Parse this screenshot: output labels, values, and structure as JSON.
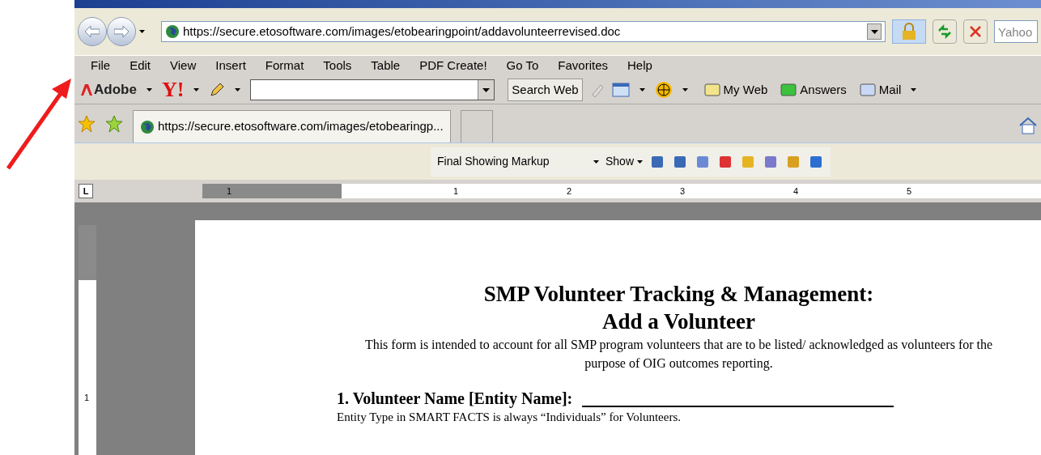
{
  "address_bar": {
    "url": "https://secure.etosoftware.com/images/etobearingpoint/addavolunteerrevised.doc"
  },
  "search_field": {
    "placeholder": "Yahoo"
  },
  "menu": [
    "File",
    "Edit",
    "View",
    "Insert",
    "Format",
    "Tools",
    "Table",
    "PDF Create!",
    "Go To",
    "Favorites",
    "Help"
  ],
  "toolbar": {
    "adobe": "Adobe",
    "yahoo": "Y!",
    "search_button": "Search Web",
    "items": [
      "My Web",
      "Answers",
      "Mail"
    ]
  },
  "tabs": [
    {
      "title": "https://secure.etosoftware.com/images/etobearingp...",
      "selected": true
    }
  ],
  "word_toolbar": {
    "markup_dropdown": "Final Showing Markup",
    "show_button": "Show"
  },
  "ruler": {
    "corner": "L",
    "labels": [
      "1",
      "1",
      "2",
      "3",
      "4",
      "5"
    ]
  },
  "vertical_ruler": {
    "labels": [
      "1"
    ]
  },
  "document": {
    "title_lines": [
      "SMP Volunteer Tracking & Management:",
      "Add a Volunteer"
    ],
    "intro": "This form is intended to account for all SMP program volunteers that are to be listed/ acknowledged as volunteers for the purpose of OIG outcomes reporting.",
    "sections": [
      {
        "heading": "1. Volunteer Name [Entity Name]:",
        "note": "Entity Type in SMART FACTS is always “Individuals” for Volunteers."
      }
    ]
  }
}
